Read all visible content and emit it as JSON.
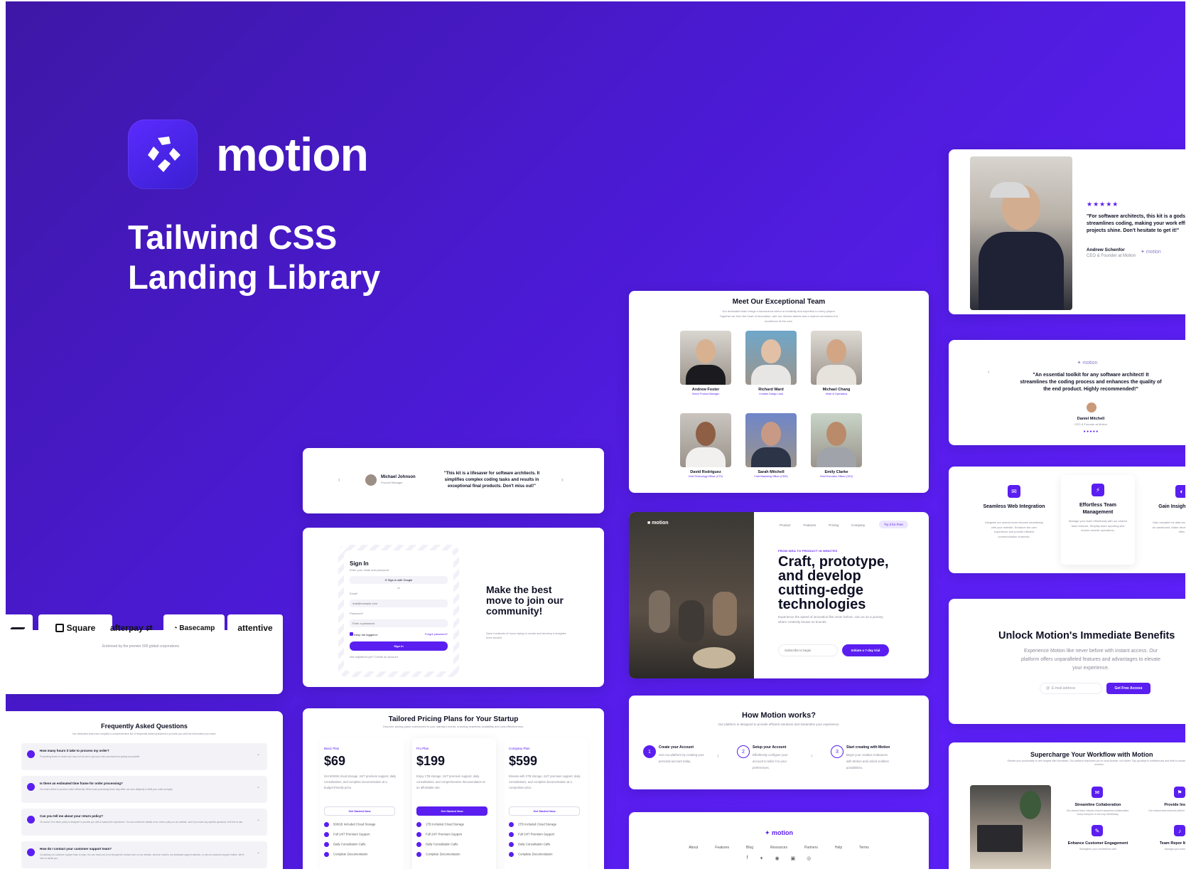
{
  "brand": {
    "name": "motion",
    "title_line1": "Tailwind CSS",
    "title_line2": "Landing Library"
  },
  "colors": {
    "accent": "#5a1ef0",
    "background_start": "#3e17a6",
    "background_end": "#5f22ff"
  },
  "testimonial_top": {
    "stars": "★★★★★",
    "quote": "\"For software architects, this kit is a godse streamlines coding, making your work effic projects shine. Don't hesitate to get it!\"",
    "author": "Andrew Schenfor",
    "role": "CEO & Founder at Motion",
    "logo": "motion"
  },
  "team": {
    "title": "Meet Our Exceptional Team",
    "subtitle": "Our dedicated team brings a harmonious blend of creativity and expertise to every project. Together we form the heart of innovation, with our diverse talents and a shared commitment to excellence at the core.",
    "members": [
      {
        "name": "Andrew Foster",
        "role": "Senior Product Manager"
      },
      {
        "name": "Richard Ward",
        "role": "Creative Design Lead"
      },
      {
        "name": "Michael Chang",
        "role": "Head of Operations"
      },
      {
        "name": "David Rodriguez",
        "role": "Chief Technology Officer (CTO)"
      },
      {
        "name": "Sarah Mitchell",
        "role": "Chief Marketing Officer (CMO)"
      },
      {
        "name": "Emily Clarke",
        "role": "Chief Executive Officer (CEO)"
      }
    ]
  },
  "testimonial_mid": {
    "logo": "motion",
    "quote": "\"An essential toolkit for any software architect! It streamlines the coding process and enhances the quality of the end product. Highly recommended!\"",
    "author": "Daniel Mitchell",
    "role": "CEO & Founder at Motion"
  },
  "testimonial_row": {
    "author": "Michael Johnson",
    "role": "Product Manager",
    "quote": "\"This kit is a lifesaver for software architects. It simplifies complex coding tasks and results in exceptional final products. Don't miss out!\""
  },
  "features_top": [
    {
      "title": "Seamless Web Integration",
      "desc": "Integrate our shared team inboxes seamlessly with your website. Enhance the user experience and provide efficient communication channels."
    },
    {
      "title": "Effortless Team Management",
      "desc": "Manage your team effortlessly with our shared team inboxes. Simplify team reporting and ensure smooth operations."
    },
    {
      "title": "Gain Insight Analyti",
      "desc": "Gain valuable ins data analytics fo through our an dashboard. Make decisions and tr progress effec"
    }
  ],
  "signin": {
    "title": "Sign In",
    "subtitle": "Enter your email and password",
    "google": "Sign in with Google",
    "or": "or",
    "email_label": "Email*",
    "email_placeholder": "mail@example.com",
    "password_label": "Password*",
    "password_placeholder": "Enter a password",
    "keep": "Keep me logged in",
    "forgot": "Forgot password?",
    "button": "Sign in",
    "footer": "Not registered yet? Create an Account",
    "headline": "Make the best move to join our community!",
    "headline_sub": "Save hundreds of hours trying to create and develop a template from scratch."
  },
  "hero_card": {
    "logo": "motion",
    "nav": [
      "Product",
      "Features",
      "Pricing",
      "Company"
    ],
    "cta": "Try it for Free",
    "eyebrow": "FROM IDEA TO PRODUCT IN MINUTES",
    "headline": "Craft, prototype, and develop cutting-edge technologies",
    "desc": "Experience the speed of innovation like never before. Join us on a journey where creativity knows no bounds.",
    "input_placeholder": "Subscribe to begin",
    "button": "Initiate a 7-day trial"
  },
  "benefits": {
    "title": "Unlock Motion's Immediate Benefits",
    "desc": "Experience Motion like never before with instant access. Our platform offers unparalleled features and advantages to elevate your experience.",
    "placeholder": "E-mail address",
    "button": "Get Free Access"
  },
  "logos": {
    "caption": "Endorsed by the premier 500 global corporations",
    "items": [
      "Square",
      "afterpay",
      "Basecamp",
      "attentive"
    ]
  },
  "faq": {
    "title": "Frequently Asked Questions",
    "subtitle": "Our dedicated team has compiled a comprehensive list of frequently asked questions to provide you with the information you need.",
    "items": [
      {
        "q": "How many hours it take to process my order?",
        "a": "Processing times for orders can vary, but we aim to get your order processed as quickly as possible."
      },
      {
        "q": "Is there an estimated time frame for order processing?",
        "a": "Our team strives to process orders efficiently. While exact processing times may differ, we work diligently to fulfill your order promptly."
      },
      {
        "q": "Can you tell me about your return policy?",
        "a": "Of course! Our return policy is designed to provide you with a hassle-free experience. You can review the details of our return policy on our website, and if you have any specific questions, feel free to ask."
      },
      {
        "q": "How do I contact your customer support team?",
        "a": "Contacting our customer support team is easy. You can reach out to us through the contact form on our website, send an email to our dedicated support address, or call our customer support hotline. We're here to assist you."
      }
    ]
  },
  "pricing": {
    "title": "Tailored Pricing Plans for Your Startup",
    "subtitle": "Discover pricing plans customized to your startup's needs, ensuring seamless scalability and cost-effectiveness.",
    "plans": [
      {
        "name": "Basic Plan",
        "price": "$69",
        "desc": "Get 500GB cloud storage, 24/7 premium support, daily consultations, and complete documentation at a budget-friendly price.",
        "button": "Get Started Now",
        "features": [
          "500GB Included Cloud Storage",
          "Full 24/7 Premium Support",
          "Daily Consultation Calls",
          "Complete Documentation"
        ]
      },
      {
        "name": "Pro Plan",
        "price": "$199",
        "desc": "Enjoy 1TB storage, 24/7 premium support, daily consultations, and comprehensive documentation at an affordable rate.",
        "button": "Get Started Now",
        "features": [
          "1TB Included Cloud Storage",
          "Full 24/7 Premium Support",
          "Daily Consultation Calls",
          "Complete Documentation"
        ]
      },
      {
        "name": "Company Plan",
        "price": "$599",
        "desc": "Elevate with 2TB storage, 24/7 premium support, daily consultations, and complete documentation at a competitive price.",
        "button": "Get Started Now",
        "features": [
          "2TB Included Cloud Storage",
          "Full 24/7 Premium Support",
          "Daily Consultation Calls",
          "Complete Documentation"
        ]
      }
    ]
  },
  "how": {
    "title": "How Motion works?",
    "subtitle": "Our platform is designed to provide efficient solutions and streamline your experience.",
    "steps": [
      {
        "n": "1",
        "title": "Create your Account",
        "desc": "Join our platform by creating your personal account today."
      },
      {
        "n": "2",
        "title": "Setup your Account",
        "desc": "Effortlessly configure your account to tailor it to your preferences."
      },
      {
        "n": "3",
        "title": "Start creating with Motion",
        "desc": "Begin your creative endeavors with Motion and unlock endless possibilities."
      }
    ]
  },
  "footer": {
    "logo": "motion",
    "links": [
      "About",
      "Features",
      "Blog",
      "Resources",
      "Partners",
      "Help",
      "Terms"
    ]
  },
  "workflow": {
    "title": "Supercharge Your Workflow with Motion",
    "subtitle": "Elevate your productivity to new heights with Wordbase. Our platform empowers you to work smarter, not harder. Say goodbye to inefficiencies and hello to streamlined success.",
    "items": [
      {
        "title": "Streamline Collaboration",
        "desc": "Our shared team inboxes ensure seamless collaboration. Keep everyone in the loop effortlessly."
      },
      {
        "title": "Provide Instant R",
        "desc": "Our shared team inboxes deliver quick and accu instantly."
      },
      {
        "title": "Enhance Customer Engagement",
        "desc": "Strengthen your connections with"
      },
      {
        "title": "Team Repor Managem",
        "desc": "Manage your team manually"
      }
    ]
  }
}
